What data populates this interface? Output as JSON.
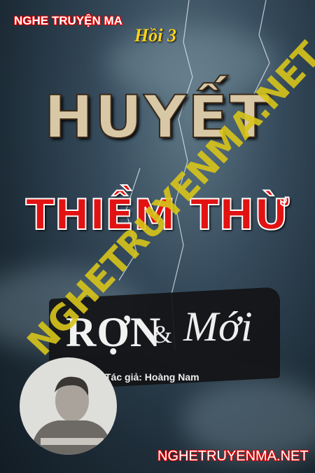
{
  "top_site": "NGHE TRUYỆN MA",
  "episode": "Hồi 3",
  "title_line1": "HUYẾT",
  "title_line2": "THIỀM THỪ",
  "brand": {
    "part1": "RỢN",
    "amp": "&",
    "part2": "Mới"
  },
  "author": "Tác giả: Hoàng Nam",
  "watermark": "NGHETRUYENMA.NET",
  "bottom_site": "NGHETRUYENMA.NET",
  "colors": {
    "accent_red": "#e21212",
    "watermark_yellow": "#d8c51a",
    "episode_yellow": "#ffd21a"
  }
}
